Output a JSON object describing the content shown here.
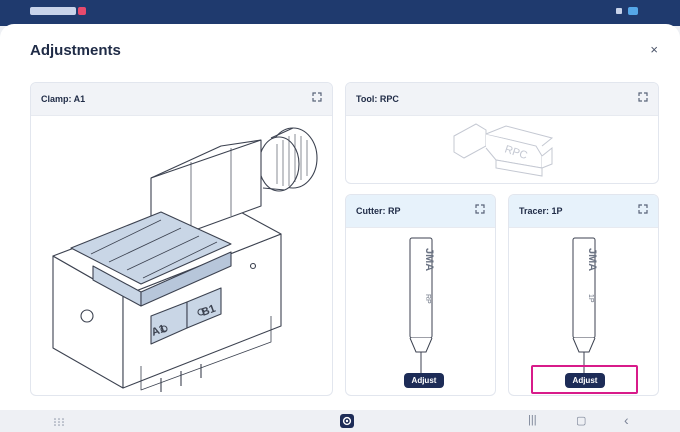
{
  "dialog": {
    "title": "Adjustments",
    "close_glyph": "×"
  },
  "panels": {
    "clamp": {
      "label": "Clamp: A1",
      "expand_icon": "expand-icon"
    },
    "tool": {
      "label": "Tool: RPC",
      "expand_icon": "expand-icon",
      "engraving": "RPC"
    },
    "cutter": {
      "label": "Cutter: RP",
      "expand_icon": "expand-icon",
      "button_label": "Adjust",
      "engraving_brand": "JMA",
      "engraving_code": "RP"
    },
    "tracer": {
      "label": "Tracer: 1P",
      "expand_icon": "expand-icon",
      "button_label": "Adjust",
      "engraving_brand": "JMA",
      "engraving_code": "1P"
    }
  },
  "clamp_markings": {
    "side_a": "A1",
    "side_b": "B1"
  },
  "navbar": {
    "recent_glyph": "|||",
    "home_glyph": "▢",
    "back_glyph": "‹"
  },
  "colors": {
    "accent": "#1d2c57",
    "highlight": "#d81b8a",
    "header_blue": "#e7f2fb",
    "statusbar": "#1f3a6e"
  }
}
